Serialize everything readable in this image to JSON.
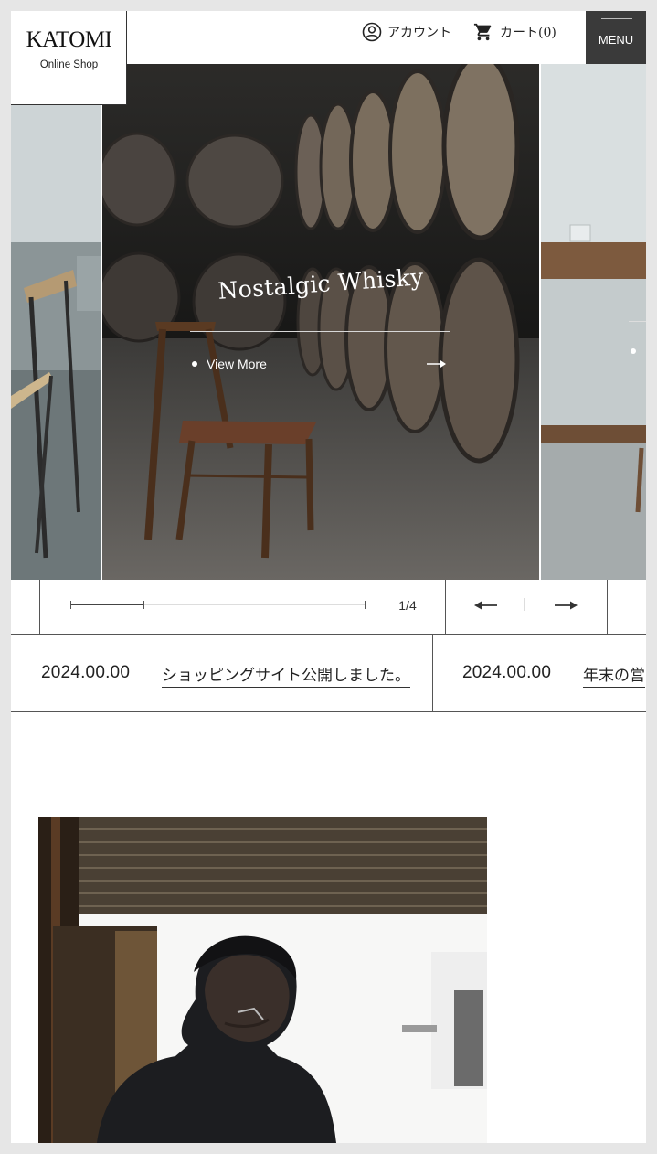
{
  "header": {
    "logo_main": "KATOMI",
    "logo_sub": "Online Shop",
    "account_label": "アカウント",
    "cart_label": "カート(0)",
    "menu_label": "MENU"
  },
  "hero": {
    "caption": "Nostalgic Whisky",
    "view_more": "View More"
  },
  "slider": {
    "counter": "1/4",
    "current": 1,
    "total": 4
  },
  "news": [
    {
      "date": "2024.00.00",
      "title": "ショッピングサイト公開しました。"
    },
    {
      "date": "2024.00.00",
      "title": "年末の営"
    }
  ],
  "icons": {
    "account": "user-circle-icon",
    "cart": "cart-icon",
    "menu": "menu-icon",
    "prev": "arrow-left-icon",
    "next": "arrow-right-icon"
  },
  "colors": {
    "menu_bg": "#3a3a3a",
    "page_bg": "#e6e6e6",
    "frame_bg": "#ffffff"
  }
}
